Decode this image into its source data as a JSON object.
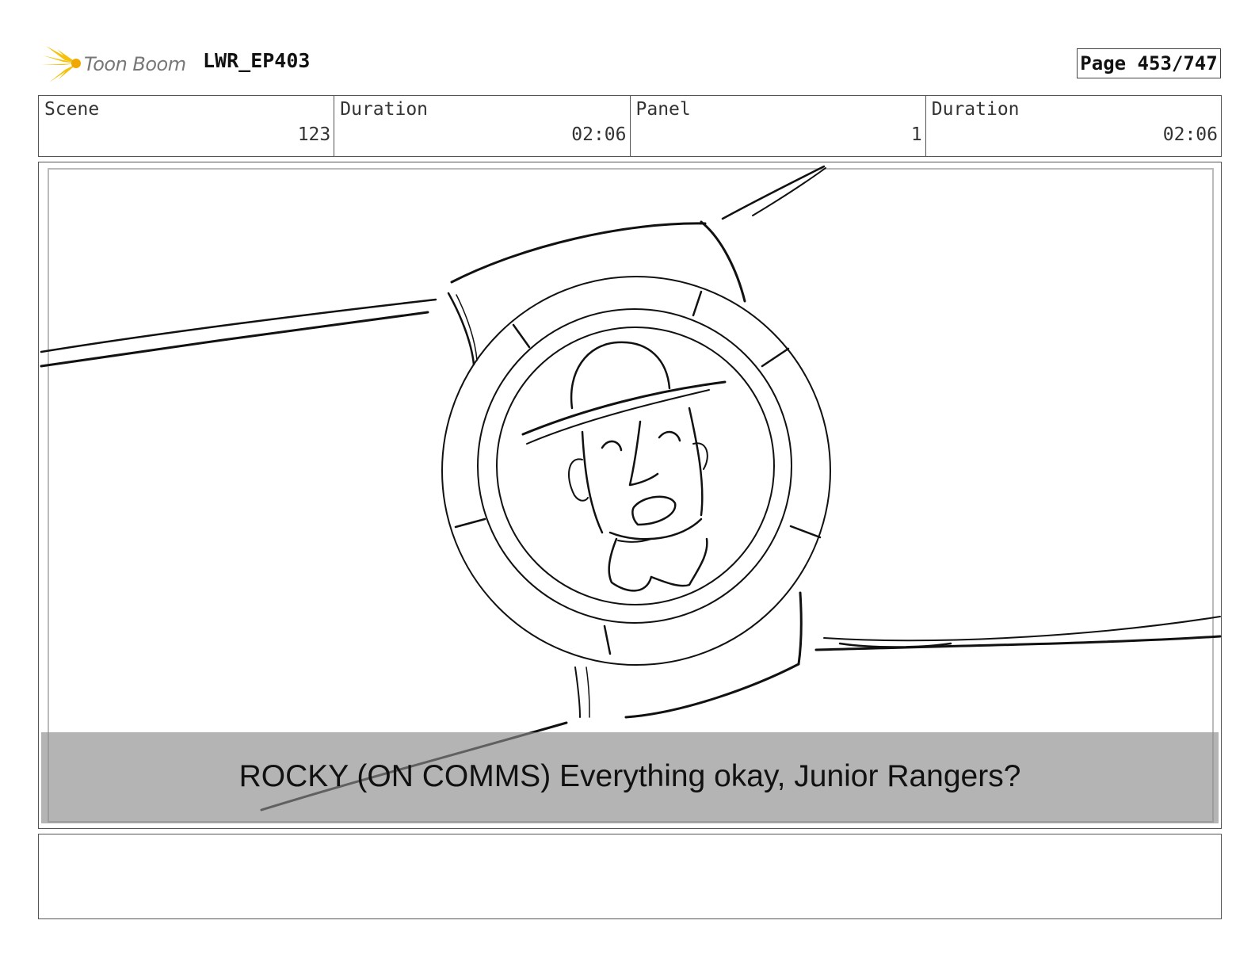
{
  "header": {
    "logo_text": "Toon Boom",
    "project_title": "LWR_EP403",
    "page_label": "Page 453/747"
  },
  "info": {
    "scene_label": "Scene",
    "scene_value": "123",
    "scene_duration_label": "Duration",
    "scene_duration_value": "02:06",
    "panel_label": "Panel",
    "panel_value": "1",
    "panel_duration_label": "Duration",
    "panel_duration_value": "02:06"
  },
  "panel": {
    "caption": "ROCKY (ON COMMS) Everything okay, Junior Rangers?"
  },
  "notes": {
    "text": ""
  }
}
